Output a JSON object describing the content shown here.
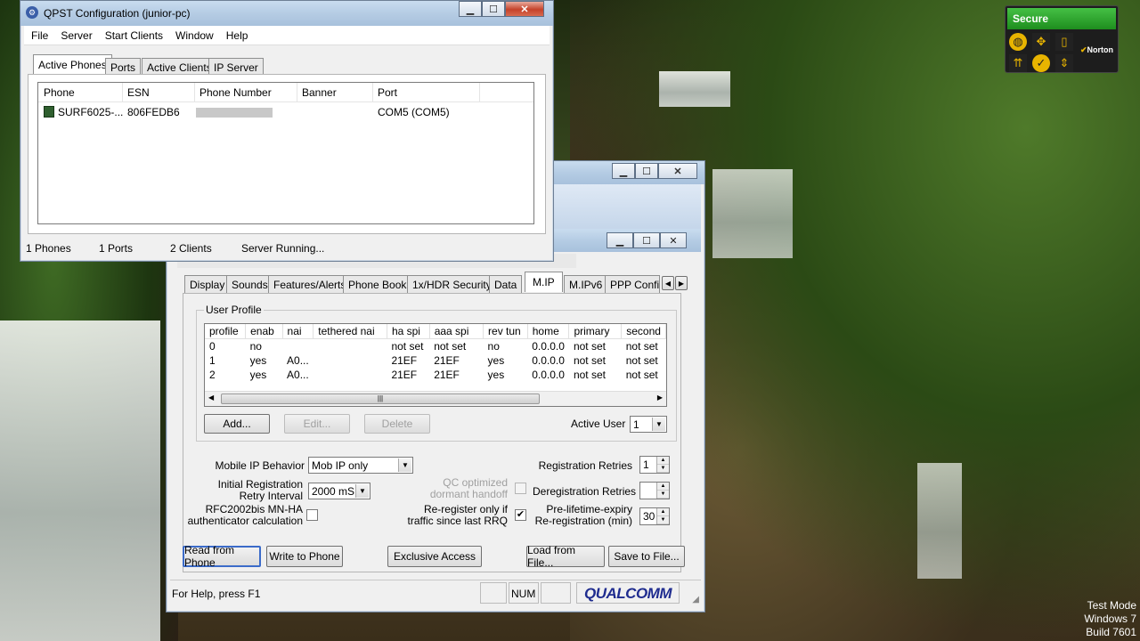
{
  "qpst": {
    "title": "QPST Configuration (junior-pc)",
    "menu": [
      "File",
      "Server",
      "Start Clients",
      "Window",
      "Help"
    ],
    "tabs": [
      "Active Phones",
      "Ports",
      "Active Clients",
      "IP Server"
    ],
    "columns": [
      "Phone",
      "ESN",
      "Phone Number",
      "Banner",
      "Port"
    ],
    "rows": [
      {
        "phone": "SURF6025-...",
        "esn": "806FEDB6",
        "number": "",
        "banner": "",
        "port": "COM5 (COM5)"
      }
    ],
    "status": [
      "1 Phones",
      "1 Ports",
      "2 Clients",
      "Server Running..."
    ]
  },
  "service": {
    "tabs": [
      "Display",
      "Sounds",
      "Features/Alerts",
      "Phone Book",
      "1x/HDR Security",
      "Data",
      "M.IP",
      "M.IPv6",
      "PPP Config"
    ],
    "user_profile": {
      "label": "User Profile",
      "columns": [
        "profile",
        "enab",
        "nai",
        "tethered nai",
        "ha spi",
        "aaa spi",
        "rev tun",
        "home",
        "primary",
        "second"
      ],
      "rows": [
        [
          "0",
          "no",
          "",
          "",
          "not set",
          "not set",
          "no",
          "0.0.0.0",
          "not set",
          "not set"
        ],
        [
          "1",
          "yes",
          "A0...",
          "",
          "21EF",
          "21EF",
          "yes",
          "0.0.0.0",
          "not set",
          "not set"
        ],
        [
          "2",
          "yes",
          "A0...",
          "",
          "21EF",
          "21EF",
          "yes",
          "0.0.0.0",
          "not set",
          "not set"
        ]
      ],
      "add": "Add...",
      "edit": "Edit...",
      "delete": "Delete",
      "active_user_label": "Active User",
      "active_user_value": "1"
    },
    "mobile_ip_behavior_label": "Mobile IP Behavior",
    "mobile_ip_behavior_value": "Mob IP only",
    "initial_reg_label1": "Initial Registration",
    "initial_reg_label2": "Retry Interval",
    "initial_reg_value": "2000 mS",
    "rfc_label1": "RFC2002bis MN-HA",
    "rfc_label2": "authenticator calculation",
    "qc_label1": "QC optimized",
    "qc_label2": "dormant handoff",
    "rereg_label1": "Re-register only if",
    "rereg_label2": "traffic since last RRQ",
    "rereg_checked": "✔",
    "reg_retries_label": "Registration Retries",
    "reg_retries_value": "1",
    "dereg_retries_label": "Deregistration Retries",
    "dereg_retries_value": "",
    "prelife_label1": "Pre-lifetime-expiry",
    "prelife_label2": "Re-registration (min)",
    "prelife_value": "30",
    "buttons": {
      "read": "Read from Phone",
      "write": "Write to Phone",
      "exclusive": "Exclusive Access",
      "load": "Load from File...",
      "save": "Save to File..."
    },
    "status_help": "For Help, press F1",
    "status_num": "NUM",
    "logo": "QUALCOMM"
  },
  "norton": {
    "status": "Secure",
    "brand": "Norton"
  },
  "watermark": [
    "Test Mode",
    "Windows 7",
    "Build 7601"
  ]
}
